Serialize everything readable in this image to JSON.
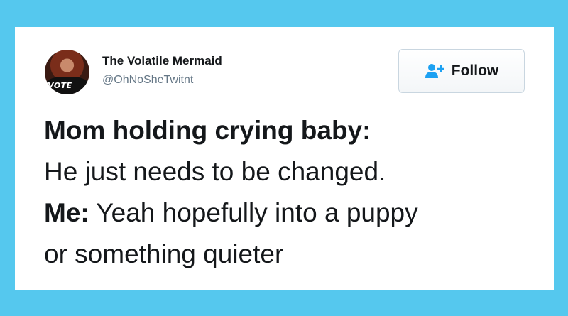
{
  "tweet": {
    "author": {
      "display_name": "The Volatile Mermaid",
      "handle": "@OhNoSheTwitnt",
      "avatar_text": "VOTE"
    },
    "follow_button": {
      "label": "Follow",
      "icon": "add-user-icon",
      "color": "#1da1f2"
    },
    "body": {
      "line1_bold": "Mom holding crying baby:",
      "line2": "He just needs to be changed.",
      "line3_bold": "Me:",
      "line3_rest": " Yeah hopefully into a puppy",
      "line4": "or something quieter"
    }
  },
  "colors": {
    "background": "#55c8ee",
    "card": "#ffffff",
    "text": "#14171a",
    "muted": "#657786"
  }
}
